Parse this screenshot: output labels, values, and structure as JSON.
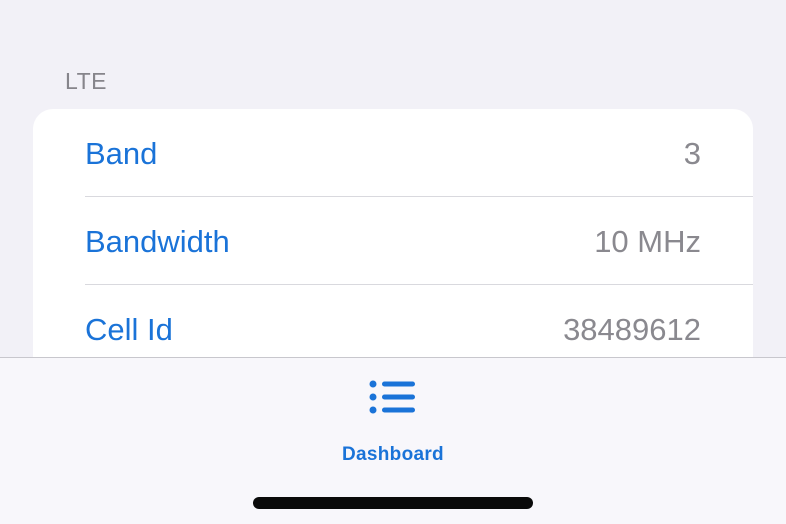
{
  "section": {
    "header": "LTE"
  },
  "rows": [
    {
      "label": "Band",
      "value": "3"
    },
    {
      "label": "Bandwidth",
      "value": "10 MHz"
    },
    {
      "label": "Cell Id",
      "value": "38489612"
    }
  ],
  "tabbar": {
    "items": [
      {
        "label": "Dashboard",
        "icon": "list-bullet-icon",
        "selected": true
      }
    ]
  },
  "colors": {
    "accent": "#1a73d8",
    "value_text": "#8a898f",
    "background": "#f2f1f7"
  }
}
